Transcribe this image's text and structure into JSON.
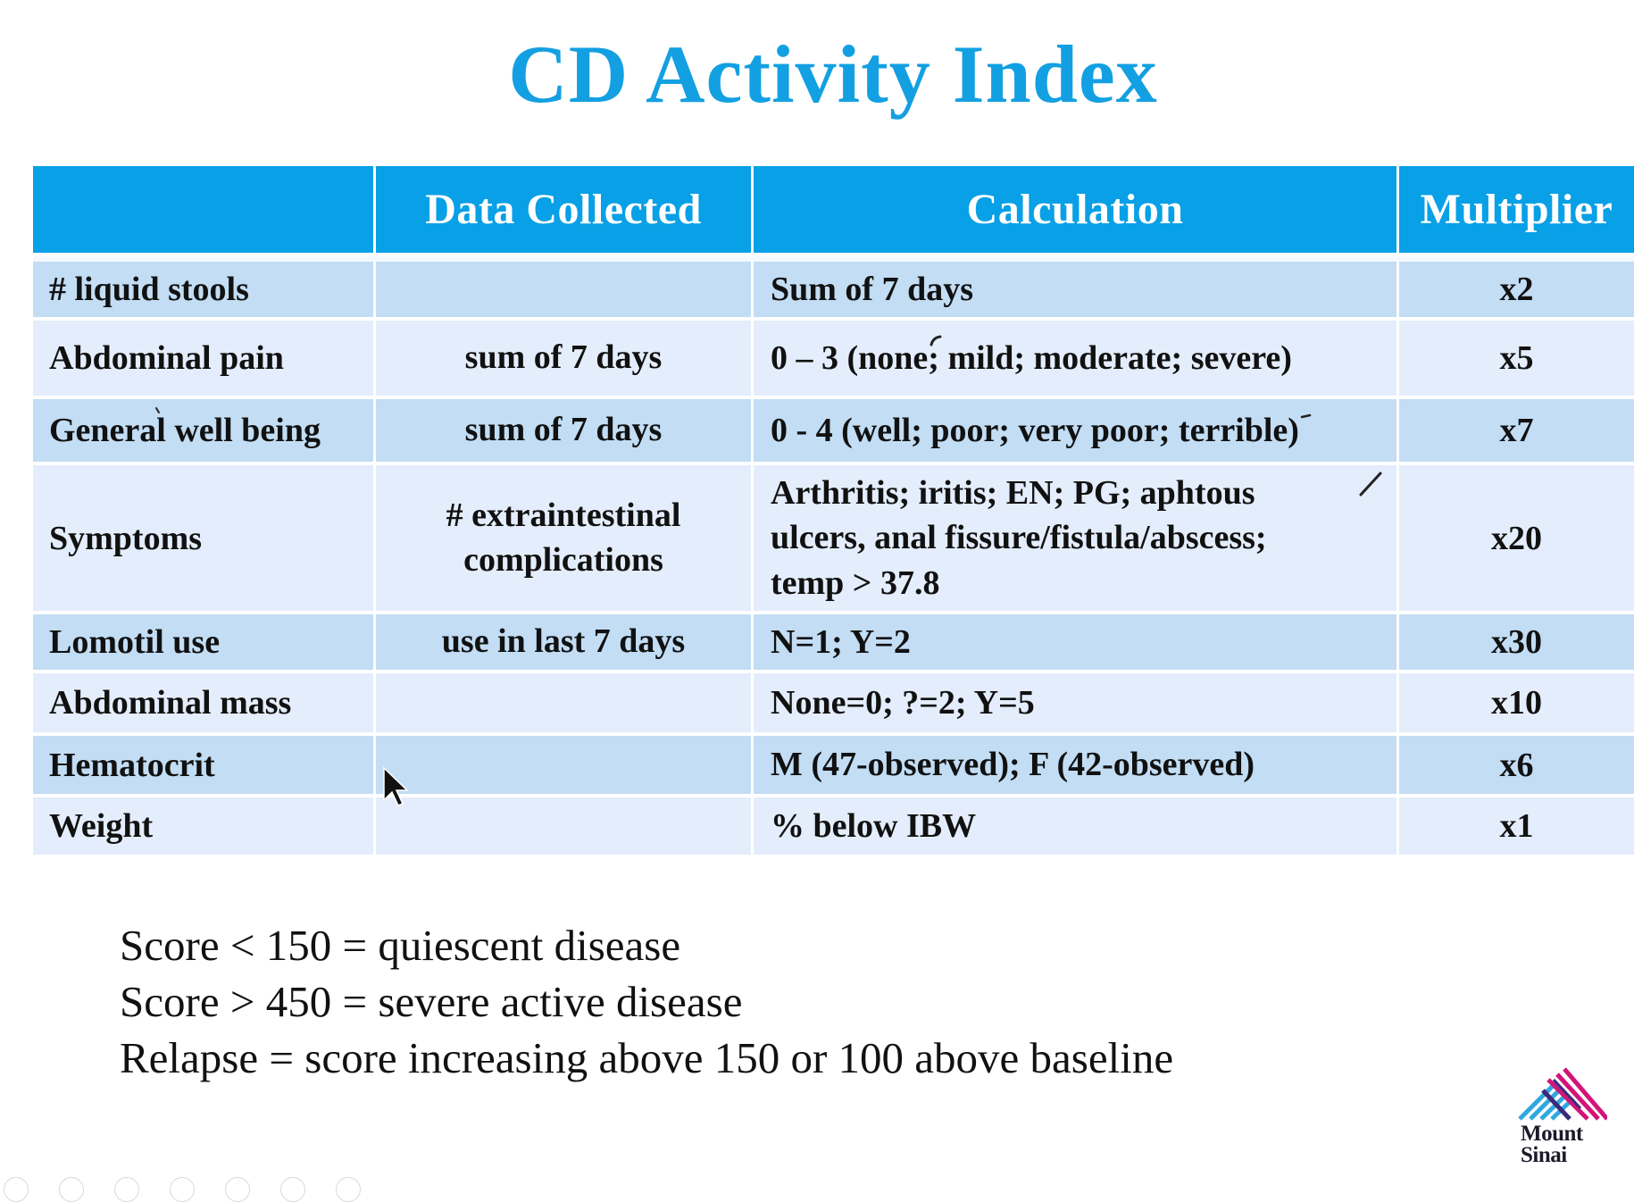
{
  "slide": {
    "title": "CD Activity Index",
    "colors": {
      "title": "#13a0e2",
      "header_bg": "#08a0e6",
      "row_dark": "#c2ddf4",
      "row_light": "#e4edfb",
      "logo_blue": "#2fa8e0",
      "logo_magenta": "#d2147a",
      "logo_purple": "#3a2a7a"
    }
  },
  "table": {
    "headers": [
      "",
      "Data Collected",
      "Calculation",
      "Multiplier"
    ],
    "rows": [
      {
        "item": "# liquid stools",
        "data_collected": "",
        "calculation": "Sum of 7 days",
        "multiplier": "x2"
      },
      {
        "item": "Abdominal pain",
        "data_collected": "sum of 7 days",
        "calculation": "0 – 3 (none; mild; moderate; severe)",
        "multiplier": "x5"
      },
      {
        "item": "General well being",
        "data_collected": "sum of 7 days",
        "calculation": "0 - 4 (well; poor; very poor; terrible)",
        "multiplier": "x7"
      },
      {
        "item": "Symptoms",
        "data_collected_lines": [
          "# extraintestinal",
          "complications"
        ],
        "calculation_lines": [
          "Arthritis; iritis; EN; PG; aphtous",
          "ulcers, anal fissure/fistula/abscess;",
          "temp > 37.8"
        ],
        "multiplier": "x20"
      },
      {
        "item": "Lomotil use",
        "data_collected": "use in last 7 days",
        "calculation": "N=1; Y=2",
        "multiplier": "x30"
      },
      {
        "item": "Abdominal mass",
        "data_collected": "",
        "calculation": "None=0; ?=2; Y=5",
        "multiplier": "x10"
      },
      {
        "item": "Hematocrit",
        "data_collected": "",
        "calculation": "M (47-observed); F (42-observed)",
        "multiplier": "x6"
      },
      {
        "item": "Weight",
        "data_collected": "",
        "calculation": "% below IBW",
        "multiplier": "x1"
      }
    ]
  },
  "notes": [
    "Score < 150 = quiescent disease",
    "Score > 450 = severe active disease",
    "Relapse = score increasing above 150 or 100 above baseline"
  ],
  "logo": {
    "icon": "mount-sinai-logo-icon",
    "line1": "Mount",
    "line2": "Sinai"
  },
  "icons": {
    "cursor": "mouse-pointer-icon",
    "slideshow_controls": [
      "previous-icon",
      "next-icon",
      "pen-icon",
      "view-icon",
      "zoom-icon",
      "subtitles-icon",
      "more-icon"
    ]
  }
}
